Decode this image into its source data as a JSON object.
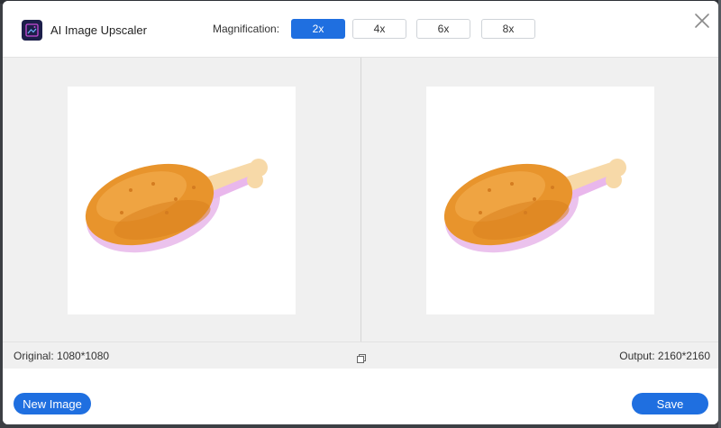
{
  "app": {
    "title": "AI Image Upscaler",
    "logo_icon": "image-sparkle-icon"
  },
  "magnification": {
    "label": "Magnification:",
    "options": [
      "2x",
      "4x",
      "6x",
      "8x"
    ],
    "selected": "2x"
  },
  "compare": {
    "original_label": "Original: 1080*1080",
    "output_label": "Output: 2160*2160",
    "image_subject": "fried-chicken-drumstick"
  },
  "footer": {
    "new_image_label": "New Image",
    "save_label": "Save"
  },
  "colors": {
    "accent": "#1f6fe0",
    "chicken": "#e8942c",
    "bone": "#f7d9a8",
    "shadow": "#e2a8e6"
  }
}
